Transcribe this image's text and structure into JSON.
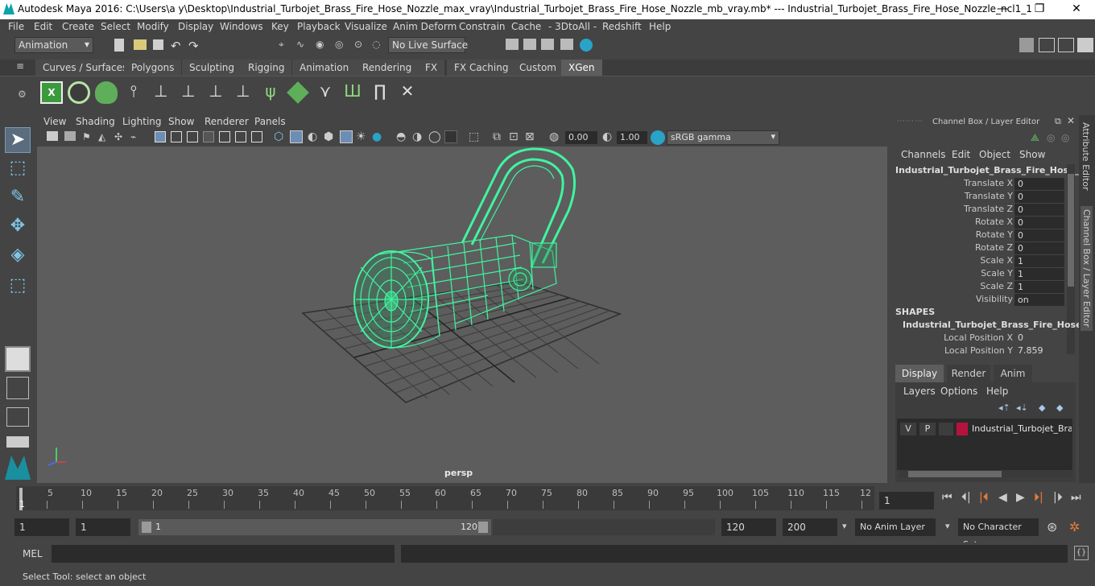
{
  "window": {
    "title": "Autodesk Maya 2016: C:\\Users\\a y\\Desktop\\Industrial_Turbojet_Brass_Fire_Hose_Nozzle_max_vray\\Industrial_Turbojet_Brass_Fire_Hose_Nozzle_mb_vray.mb*   ---   Industrial_Turbojet_Brass_Fire_Hose_Nozzle_ncl1_1",
    "minimize": "—",
    "maximize": "❐",
    "close": "✕"
  },
  "menubar": [
    "File",
    "Edit",
    "Create",
    "Select",
    "Modify",
    "Display",
    "Windows",
    "Key",
    "Playback",
    "Visualize",
    "Anim Deform",
    "Constrain",
    "Cache",
    "- 3DtoAll -",
    "Redshift",
    "Help"
  ],
  "status": {
    "mode": "Animation",
    "live_surface": "No Live Surface"
  },
  "shelf_tabs": [
    "Curves / Surfaces",
    "Polygons",
    "Sculpting",
    "Rigging",
    "Animation",
    "Rendering",
    "FX",
    "FX Caching",
    "Custom",
    "XGen"
  ],
  "shelf_active": "XGen",
  "viewport": {
    "menus": [
      "View",
      "Shading",
      "Lighting",
      "Show",
      "Renderer",
      "Panels"
    ],
    "exposure": "0.00",
    "gamma": "1.00",
    "colorspace": "sRGB gamma",
    "camera": "persp"
  },
  "channel_box": {
    "header": "Channel Box / Layer Editor",
    "menus": [
      "Channels",
      "Edit",
      "Object",
      "Show"
    ],
    "object_name": "Industrial_Turbojet_Brass_Fire_Hose_...",
    "channels": [
      {
        "label": "Translate X",
        "value": "0"
      },
      {
        "label": "Translate Y",
        "value": "0"
      },
      {
        "label": "Translate Z",
        "value": "0"
      },
      {
        "label": "Rotate X",
        "value": "0"
      },
      {
        "label": "Rotate Y",
        "value": "0"
      },
      {
        "label": "Rotate Z",
        "value": "0"
      },
      {
        "label": "Scale X",
        "value": "1"
      },
      {
        "label": "Scale Y",
        "value": "1"
      },
      {
        "label": "Scale Z",
        "value": "1"
      },
      {
        "label": "Visibility",
        "value": "on"
      }
    ],
    "shapes_label": "SHAPES",
    "shape_name": "Industrial_Turbojet_Brass_Fire_Hose...",
    "shape_channels": [
      {
        "label": "Local Position X",
        "value": "0"
      },
      {
        "label": "Local Position Y",
        "value": "7.859"
      }
    ]
  },
  "layer_editor": {
    "tabs": [
      "Display",
      "Render",
      "Anim"
    ],
    "active_tab": "Display",
    "menus": [
      "Layers",
      "Options",
      "Help"
    ],
    "layer": {
      "v": "V",
      "p": "P",
      "name": "Industrial_Turbojet_Bras",
      "color": "#b5133d"
    }
  },
  "side_tabs": [
    "Attribute Editor",
    "Channel Box / Layer Editor"
  ],
  "timeline": {
    "ticks": [
      "5",
      "10",
      "15",
      "20",
      "25",
      "30",
      "35",
      "40",
      "45",
      "50",
      "55",
      "60",
      "65",
      "70",
      "75",
      "80",
      "85",
      "90",
      "95",
      "100",
      "105",
      "110",
      "115",
      "12"
    ],
    "first": "1",
    "current_frame": "1"
  },
  "range": {
    "start": "1",
    "playback_start": "1",
    "slider_start": "1",
    "slider_end": "120",
    "playback_end": "120",
    "end": "200",
    "anim_layer": "No Anim Layer",
    "character_set": "No Character Set"
  },
  "command": {
    "label": "MEL"
  },
  "help_line": "Select Tool: select an object",
  "colors": {
    "wireframe": "#3ff5a0",
    "viewport_bg": "#5d5d5d",
    "accent": "#0ea3a8"
  }
}
